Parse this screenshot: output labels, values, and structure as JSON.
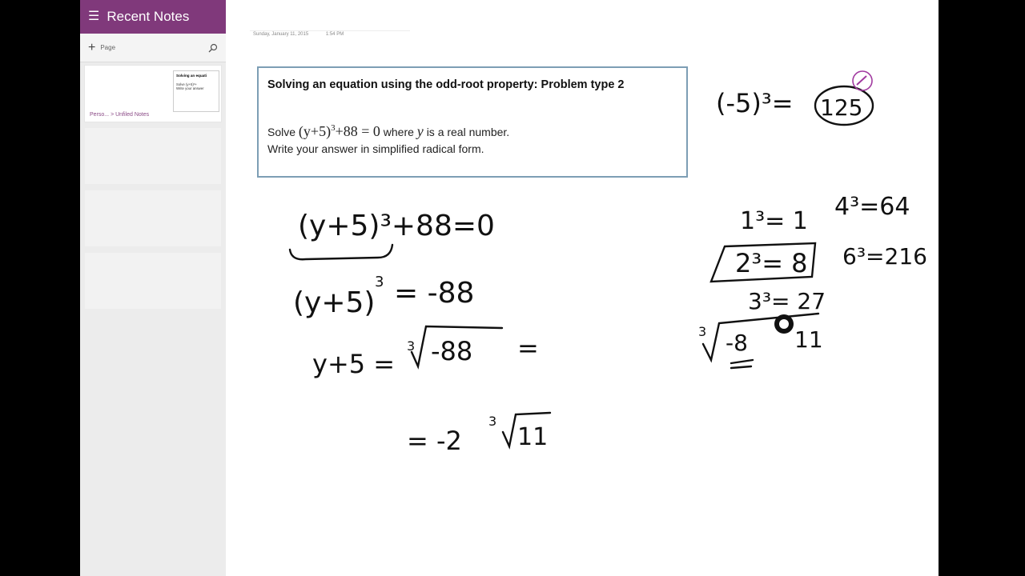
{
  "app": {
    "sidebar_title": "Recent Notes",
    "new_page_label": "Page",
    "cards": [
      {
        "thumb_title": "Solving an equati",
        "thumb_line1": "Solve (y+5)³+",
        "thumb_line2": "Write your answer",
        "breadcrumb": "Perso... > Unfiled Notes"
      }
    ]
  },
  "page_meta": {
    "date": "Sunday, January 11, 2015",
    "time": "1:54 PM"
  },
  "problem": {
    "title": "Solving an equation using the odd-root property: Problem type 2",
    "solve_word": "Solve",
    "equation_left": "(y+5)",
    "equation_exp": "3",
    "equation_right": "+88 = 0",
    "where_text": "where",
    "var": "y",
    "is_real": "is a real number.",
    "line2": "Write your answer in simplified radical form."
  },
  "handwriting": {
    "step1": "(y+5)³+88=0",
    "step2_left": "(y+5)",
    "step2_right": "= -88",
    "step3_left": "y+5 =",
    "step3_root": "-88",
    "step3_eq": "=",
    "step3_root2": "-8",
    "step3_tail": "11",
    "step4_eq": "= -2",
    "step4_tail": "11",
    "side_a": "(-5)³=",
    "side_a_ans": "125",
    "cubes": [
      "1³= 1",
      "2³= 8",
      "3³= 27"
    ],
    "cubes_right": [
      "4³=64",
      "6³=216"
    ],
    "root_index": "3"
  }
}
